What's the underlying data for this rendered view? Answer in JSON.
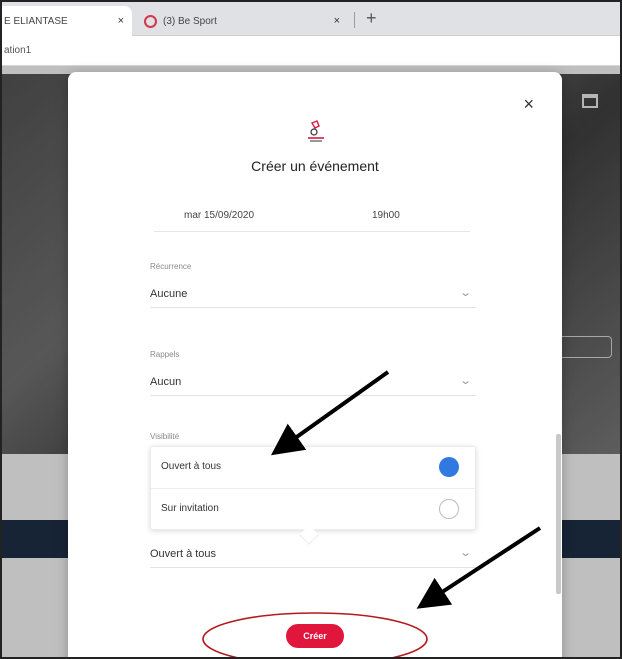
{
  "browser": {
    "tabs": [
      {
        "title": "E ELIANTASE",
        "close": "×"
      },
      {
        "title": "(3) Be Sport",
        "close": "×"
      }
    ],
    "new_tab": "+",
    "url": "ation1"
  },
  "modal": {
    "close": "×",
    "title": "Créer un événement",
    "date": "mar 15/09/2020",
    "time": "19h00",
    "recurrence_label": "Récurrence",
    "recurrence_value": "Aucune",
    "reminder_label": "Rappels",
    "reminder_value": "Aucun",
    "visibility_label": "Visibilité",
    "visibility_options": [
      {
        "label": "Ouvert à tous",
        "checked": true
      },
      {
        "label": "Sur invitation",
        "checked": false
      }
    ],
    "visibility_value": "Ouvert à tous",
    "create_button": "Créer"
  },
  "colors": {
    "accent": "#e0163d",
    "radio_checked": "#2f79e0",
    "annotation_ellipse": "#b31b1b"
  },
  "annotations": [
    "black-arrow",
    "black-arrow",
    "red-ellipse"
  ]
}
